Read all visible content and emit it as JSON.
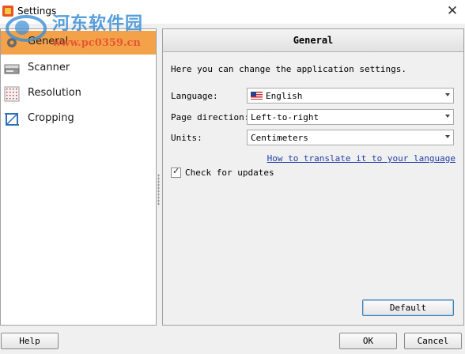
{
  "window": {
    "title": "Settings",
    "close_glyph": "✕"
  },
  "watermark": {
    "site_name": "河东软件园",
    "url": "www.pc0359.cn"
  },
  "sidebar": {
    "items": [
      {
        "label": "General",
        "icon": "gear-icon",
        "active": true
      },
      {
        "label": "Scanner",
        "icon": "scanner-icon",
        "active": false
      },
      {
        "label": "Resolution",
        "icon": "resolution-grid-icon",
        "active": false
      },
      {
        "label": "Cropping",
        "icon": "crop-icon",
        "active": false
      }
    ]
  },
  "panel": {
    "header": "General",
    "intro": "Here you can change the application settings.",
    "language": {
      "label": "Language:",
      "value": "English",
      "flag_icon": "us-flag-icon"
    },
    "page_direction": {
      "label": "Page direction:",
      "value": "Left-to-right"
    },
    "units": {
      "label": "Units:",
      "value": "Centimeters"
    },
    "translate_link": "How to translate it to your language",
    "check_updates": {
      "label": "Check for updates",
      "checked": true,
      "tick": "✓"
    },
    "default_button": "Default"
  },
  "footer": {
    "help_button": "Help",
    "ok_button": "OK",
    "cancel_button": "Cancel"
  },
  "colors": {
    "accent": "#f4a24a",
    "link": "#2340a8",
    "default_button_border": "#3c7fb1"
  }
}
